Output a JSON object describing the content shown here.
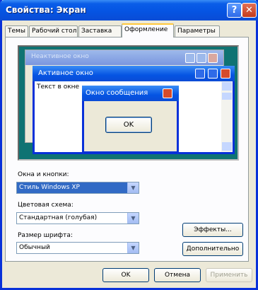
{
  "window": {
    "title": "Свойства: Экран"
  },
  "tabs": [
    {
      "label": "Темы"
    },
    {
      "label": "Рабочий стол"
    },
    {
      "label": "Заставка"
    },
    {
      "label": "Оформление"
    },
    {
      "label": "Параметры"
    }
  ],
  "preview": {
    "inactive_title": "Неактивное окно",
    "active_title": "Активное окно",
    "window_text": "Текст в окне",
    "message_title": "Окно сообщения",
    "message_ok": "OK"
  },
  "form": {
    "windows_buttons_label": "Окна и кнопки:",
    "windows_buttons_value": "Стиль Windows XP",
    "color_scheme_label": "Цветовая схема:",
    "color_scheme_value": "Стандартная (голубая)",
    "font_size_label": "Размер шрифта:",
    "font_size_value": "Обычный",
    "effects_button": "Эффекты...",
    "advanced_button": "Дополнительно"
  },
  "footer": {
    "ok": "OK",
    "cancel": "Отмена",
    "apply": "Применить"
  }
}
